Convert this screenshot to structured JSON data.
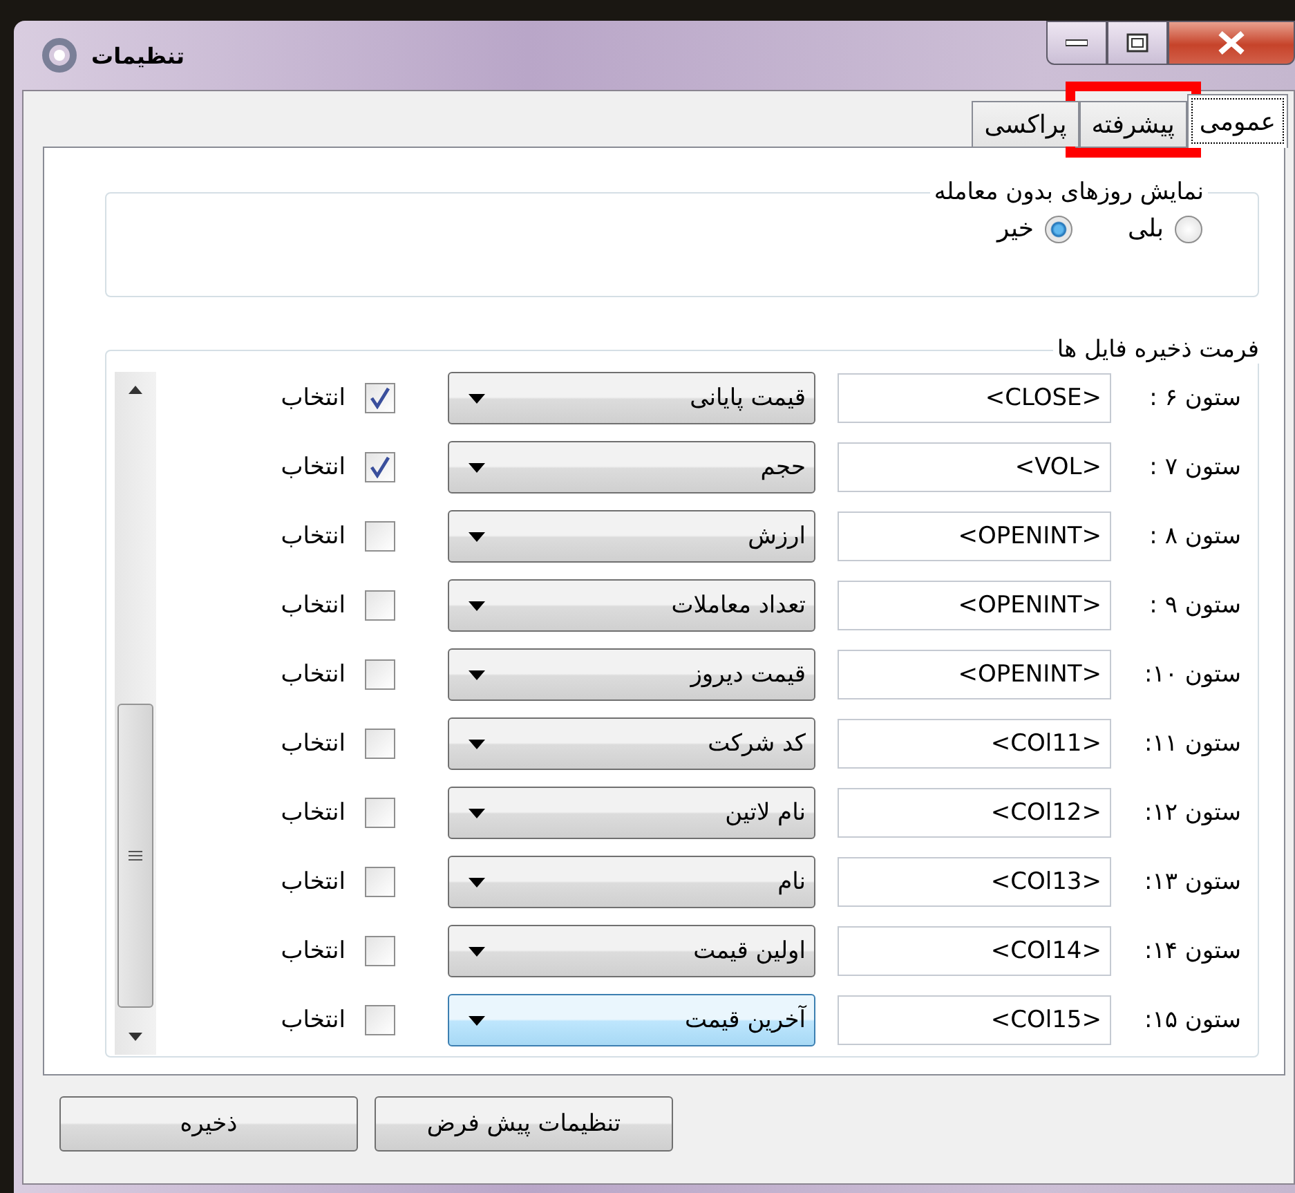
{
  "window": {
    "title": "تنظیمات"
  },
  "tabs": [
    {
      "label": "عمومی",
      "selected": true,
      "annotated": false
    },
    {
      "label": "پیشرفته",
      "selected": false,
      "annotated": true
    },
    {
      "label": "پراکسی",
      "selected": false,
      "annotated": false
    }
  ],
  "no_trade_days": {
    "title": "نمایش روزهای بدون معامله",
    "options": [
      {
        "label": "بلی",
        "selected": false
      },
      {
        "label": "خیر",
        "selected": true
      }
    ]
  },
  "file_format": {
    "title": "فرمت ذخیره فایل ها",
    "rows": [
      {
        "label": "ستون ۶ :",
        "field": "<CLOSE>",
        "choice": "قیمت پایانی",
        "checkbox": "انتخاب",
        "checked": true,
        "focused": false
      },
      {
        "label": "ستون ۷ :",
        "field": "<VOL>",
        "choice": "حجم",
        "checkbox": "انتخاب",
        "checked": true,
        "focused": false
      },
      {
        "label": "ستون ۸ :",
        "field": "<OPENINT>",
        "choice": "ارزش",
        "checkbox": "انتخاب",
        "checked": false,
        "focused": false
      },
      {
        "label": "ستون ۹ :",
        "field": "<OPENINT>",
        "choice": "تعداد معاملات",
        "checkbox": "انتخاب",
        "checked": false,
        "focused": false
      },
      {
        "label": "ستون ۱۰:",
        "field": "<OPENINT>",
        "choice": "قیمت دیروز",
        "checkbox": "انتخاب",
        "checked": false,
        "focused": false
      },
      {
        "label": "ستون ۱۱:",
        "field": "<COl11>",
        "choice": "کد شرکت",
        "checkbox": "انتخاب",
        "checked": false,
        "focused": false
      },
      {
        "label": "ستون ۱۲:",
        "field": "<COl12>",
        "choice": "نام لاتین",
        "checkbox": "انتخاب",
        "checked": false,
        "focused": false
      },
      {
        "label": "ستون ۱۳:",
        "field": "<COl13>",
        "choice": "نام",
        "checkbox": "انتخاب",
        "checked": false,
        "focused": false
      },
      {
        "label": "ستون ۱۴:",
        "field": "<COl14>",
        "choice": "اولین قیمت",
        "checkbox": "انتخاب",
        "checked": false,
        "focused": false
      },
      {
        "label": "ستون ۱۵:",
        "field": "<COl15>",
        "choice": "آخرین قیمت",
        "checkbox": "انتخاب",
        "checked": false,
        "focused": true
      }
    ]
  },
  "buttons": [
    "تنظیمات پیش فرض",
    "ذخیره"
  ]
}
